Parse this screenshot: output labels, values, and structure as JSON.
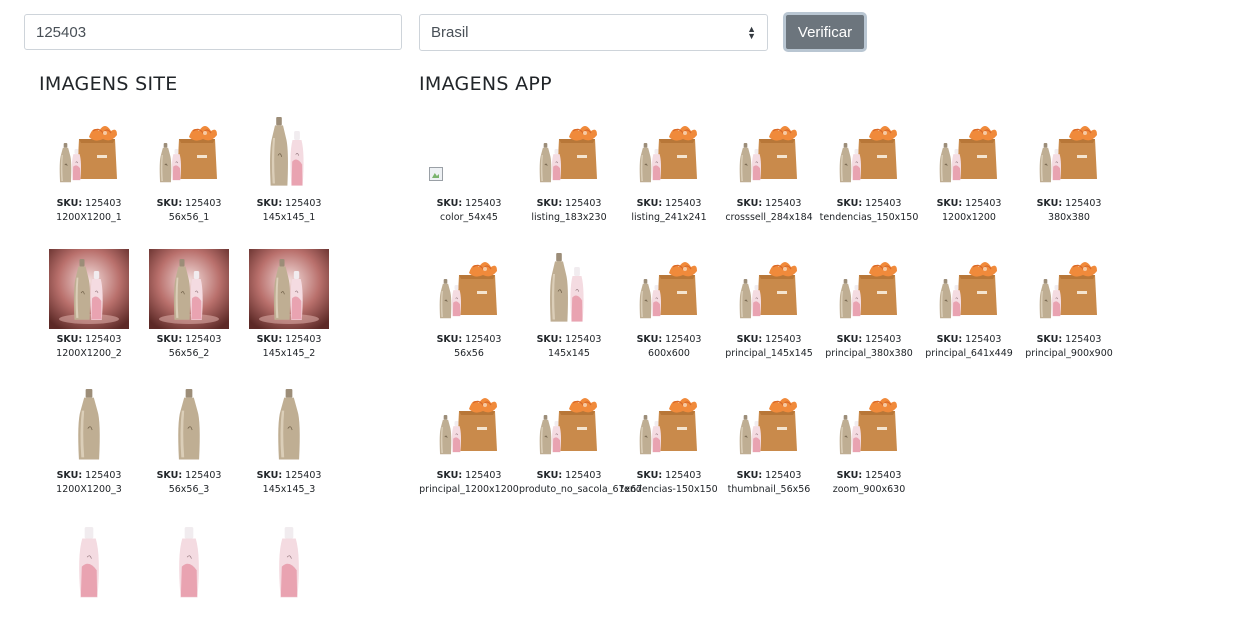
{
  "form": {
    "sku_value": "125403",
    "country_value": "Brasil",
    "verify_label": "Verificar"
  },
  "site": {
    "title": "IMAGENS SITE",
    "items": [
      {
        "sku_label": "SKU:",
        "sku": "125403",
        "name": "1200X1200_1",
        "kind": "kit"
      },
      {
        "sku_label": "SKU:",
        "sku": "125403",
        "name": "56x56_1",
        "kind": "kit"
      },
      {
        "sku_label": "SKU:",
        "sku": "125403",
        "name": "145x145_1",
        "kind": "pair"
      },
      {
        "sku_label": "SKU:",
        "sku": "125403",
        "name": "1200X1200_2",
        "kind": "scene"
      },
      {
        "sku_label": "SKU:",
        "sku": "125403",
        "name": "56x56_2",
        "kind": "scene"
      },
      {
        "sku_label": "SKU:",
        "sku": "125403",
        "name": "145x145_2",
        "kind": "scene"
      },
      {
        "sku_label": "SKU:",
        "sku": "125403",
        "name": "1200X1200_3",
        "kind": "gold"
      },
      {
        "sku_label": "SKU:",
        "sku": "125403",
        "name": "56x56_3",
        "kind": "gold"
      },
      {
        "sku_label": "SKU:",
        "sku": "125403",
        "name": "145x145_3",
        "kind": "gold"
      },
      {
        "kind": "pink"
      },
      {
        "kind": "pink"
      },
      {
        "kind": "pink"
      }
    ]
  },
  "app": {
    "title": "IMAGENS APP",
    "items": [
      {
        "sku_label": "SKU:",
        "sku": "125403",
        "name": "color_54x45",
        "kind": "broken"
      },
      {
        "sku_label": "SKU:",
        "sku": "125403",
        "name": "listing_183x230",
        "kind": "kit"
      },
      {
        "sku_label": "SKU:",
        "sku": "125403",
        "name": "listing_241x241",
        "kind": "kit"
      },
      {
        "sku_label": "SKU:",
        "sku": "125403",
        "name": "crosssell_284x184",
        "kind": "kit"
      },
      {
        "sku_label": "SKU:",
        "sku": "125403",
        "name": "tendencias_150x150",
        "kind": "kit"
      },
      {
        "sku_label": "SKU:",
        "sku": "125403",
        "name": "1200x1200",
        "kind": "kit"
      },
      {
        "sku_label": "SKU:",
        "sku": "125403",
        "name": "380x380",
        "kind": "kit"
      },
      {
        "sku_label": "SKU:",
        "sku": "125403",
        "name": "56x56",
        "kind": "kit"
      },
      {
        "sku_label": "SKU:",
        "sku": "125403",
        "name": "145x145",
        "kind": "pair"
      },
      {
        "sku_label": "SKU:",
        "sku": "125403",
        "name": "600x600",
        "kind": "kit"
      },
      {
        "sku_label": "SKU:",
        "sku": "125403",
        "name": "principal_145x145",
        "kind": "kit"
      },
      {
        "sku_label": "SKU:",
        "sku": "125403",
        "name": "principal_380x380",
        "kind": "kit"
      },
      {
        "sku_label": "SKU:",
        "sku": "125403",
        "name": "principal_641x449",
        "kind": "kit"
      },
      {
        "sku_label": "SKU:",
        "sku": "125403",
        "name": "principal_900x900",
        "kind": "kit"
      },
      {
        "sku_label": "SKU:",
        "sku": "125403",
        "name": "principal_1200x1200",
        "kind": "kit"
      },
      {
        "sku_label": "SKU:",
        "sku": "125403",
        "name": "produto_no_sacola_67x67",
        "kind": "kit"
      },
      {
        "sku_label": "SKU:",
        "sku": "125403",
        "name": "tendencias-150x150",
        "kind": "kit"
      },
      {
        "sku_label": "SKU:",
        "sku": "125403",
        "name": "thumbnail_56x56",
        "kind": "kit"
      },
      {
        "sku_label": "SKU:",
        "sku": "125403",
        "name": "zoom_900x630",
        "kind": "kit"
      }
    ]
  }
}
